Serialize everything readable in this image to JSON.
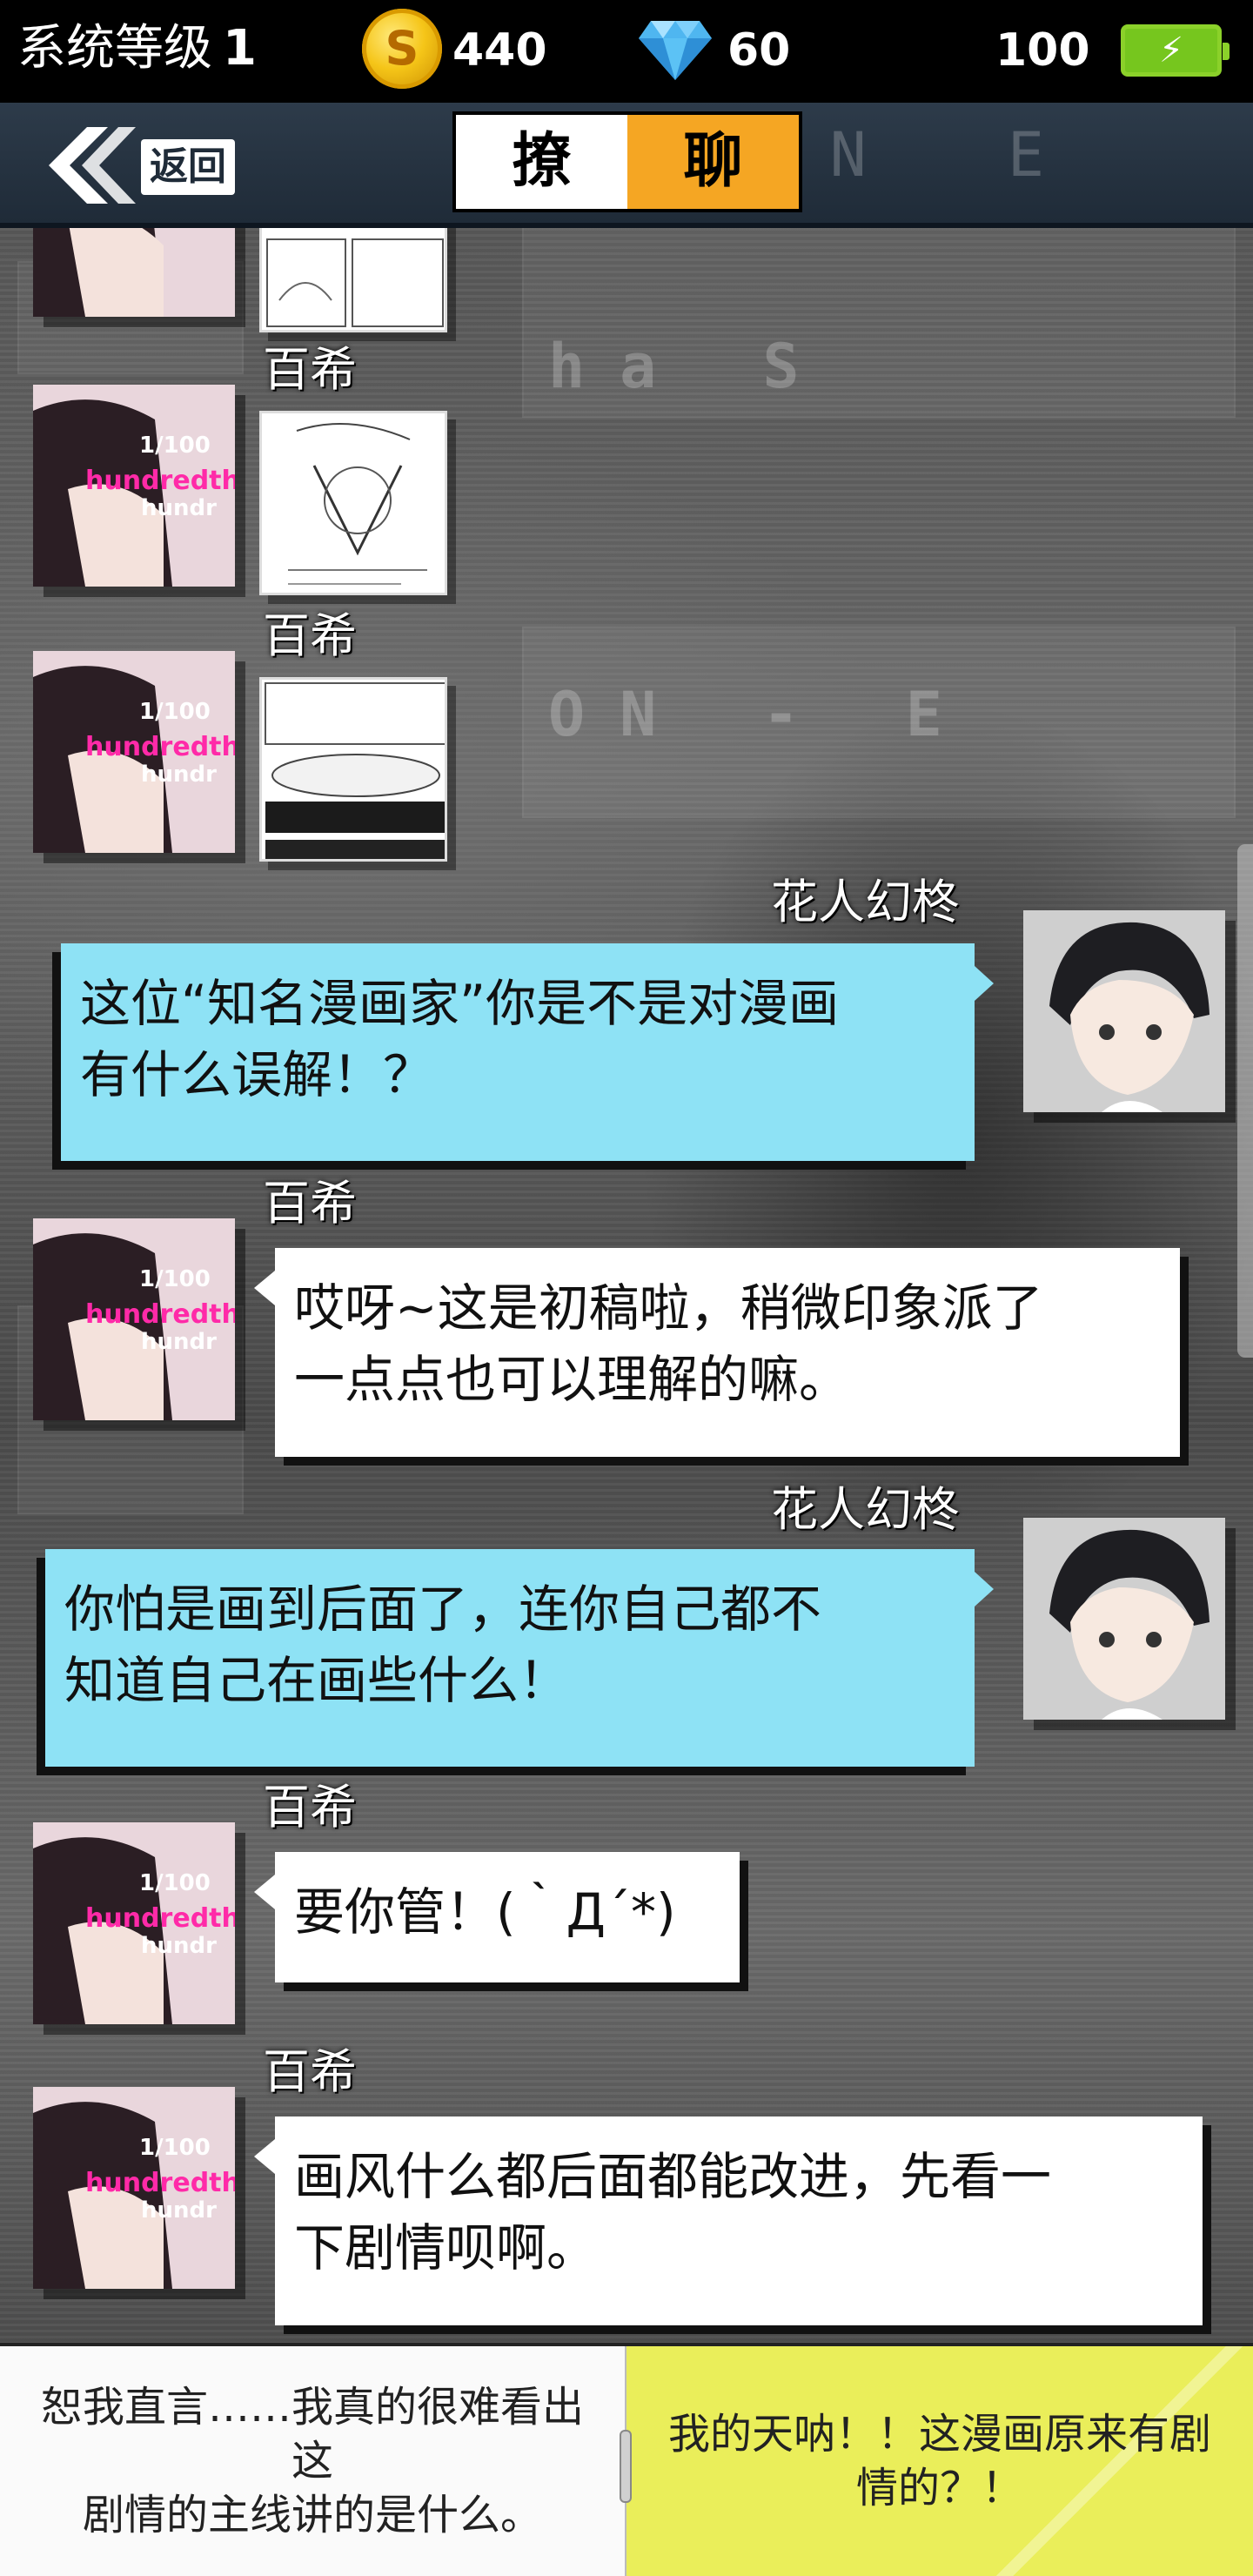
{
  "status_bar": {
    "level_label": "系统等级",
    "level_value": "1",
    "coins": "440",
    "gems": "60",
    "battery": "100",
    "icons": [
      "coin-icon",
      "diamond-icon",
      "battery-charging-icon"
    ]
  },
  "header": {
    "back_label": "返回",
    "title_left": "撩",
    "title_right": "聊",
    "accent_color": "#f5a623"
  },
  "messages": [
    {
      "sender": "百希",
      "type": "image",
      "side": "left"
    },
    {
      "sender": "百希",
      "type": "image",
      "side": "left"
    },
    {
      "sender": "花人幻柊",
      "type": "text",
      "side": "right",
      "text_lines": [
        "这位“知名漫画家”你是不是对漫画",
        "有什么误解！？"
      ]
    },
    {
      "sender": "百希",
      "type": "text",
      "side": "left",
      "text_lines": [
        "哎呀~这是初稿啦，稍微印象派了",
        "一点点也可以理解的嘛。"
      ]
    },
    {
      "sender": "花人幻柊",
      "type": "text",
      "side": "right",
      "text_lines": [
        "你怕是画到后面了，连你自己都不",
        "知道自己在画些什么！"
      ]
    },
    {
      "sender": "百希",
      "type": "text",
      "side": "left",
      "text_lines": [
        "要你管！(｀Д´*)"
      ]
    },
    {
      "sender": "百希",
      "type": "text",
      "side": "left",
      "text_lines": [
        "画风什么都后面都能改进，先看一",
        "下剧情呗啊。"
      ]
    }
  ],
  "avatar_text": {
    "line1": "1/100",
    "line2": "hundredth",
    "line3": "hundr"
  },
  "choices": [
    {
      "lines": [
        "恕我直言……我真的很难看出这",
        "剧情的主线讲的是什么。"
      ]
    },
    {
      "lines": [
        "我的天呐！！这漫画原来有剧",
        "情的？！"
      ]
    }
  ],
  "colors": {
    "bubble_blue": "#8ee2f5",
    "bubble_white": "#ffffff",
    "choice_highlight": "#eaee5a"
  }
}
